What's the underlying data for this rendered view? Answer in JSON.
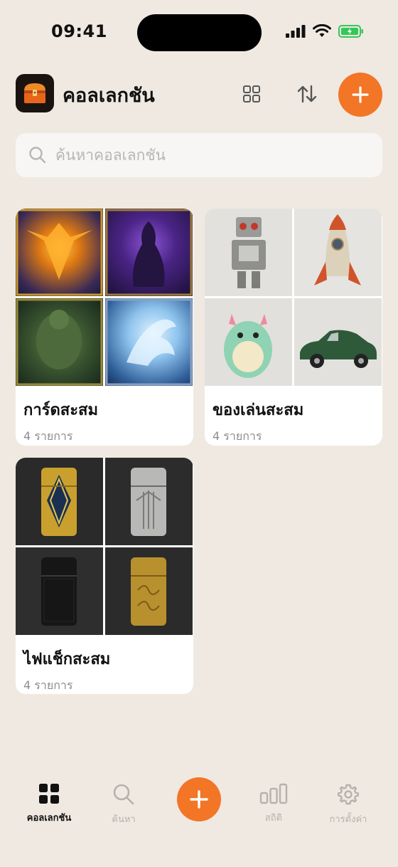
{
  "status": {
    "time": "09:41"
  },
  "header": {
    "title": "คอลเลกชัน"
  },
  "search": {
    "placeholder": "ค้นหาคอลเลกชัน"
  },
  "collections": [
    {
      "name": "การ์ดสะสม",
      "count": "4 รายการ",
      "items": [
        "phoenix-card",
        "dark-sorceress-card",
        "forest-golem-card",
        "ice-dragon-card"
      ]
    },
    {
      "name": "ของเล่นสะสม",
      "count": "4 รายการ",
      "items": [
        "tin-robot",
        "tin-rocket",
        "green-monster-figure",
        "green-classic-car"
      ]
    },
    {
      "name": "ไฟแช็กสะสม",
      "count": "4 รายการ",
      "items": [
        "gold-art-deco-lighter",
        "silver-lighter",
        "black-lighter",
        "brass-engraved-lighter"
      ]
    }
  ],
  "tabs": [
    {
      "label": "คอลเลกชัน",
      "icon": "grid-icon",
      "active": true
    },
    {
      "label": "ค้นหา",
      "icon": "search-icon"
    },
    {
      "label": "สถิติ",
      "icon": "stats-icon"
    },
    {
      "label": "การตั้งค่า",
      "icon": "gear-icon"
    }
  ],
  "colors": {
    "accent": "#f37526",
    "background": "#efe9e1"
  }
}
